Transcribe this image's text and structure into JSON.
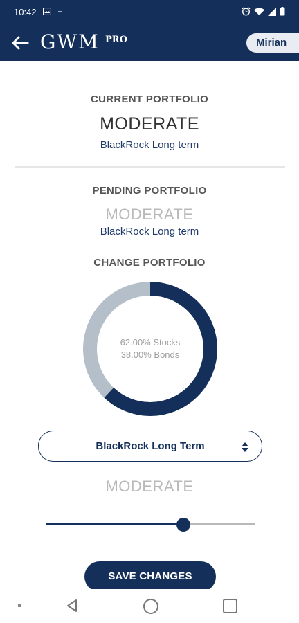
{
  "status_bar": {
    "time": "10:42"
  },
  "header": {
    "brand": "GWM",
    "brand_sup": "PRO",
    "user_name": "Mirian"
  },
  "current": {
    "title": "CURRENT PORTFOLIO",
    "level": "MODERATE",
    "provider": "BlackRock Long term"
  },
  "pending": {
    "title": "PENDING PORTFOLIO",
    "level": "MODERATE",
    "provider": "BlackRock Long term"
  },
  "change": {
    "title": "CHANGE PORTFOLIO",
    "stocks_text": "62.00% Stocks",
    "bonds_text": "38.00% Bonds",
    "stocks_fraction": 0.62,
    "stocks_color": "#14305a",
    "bonds_color": "#b5bfc9",
    "select_value": "BlackRock Long Term",
    "risk_level": "MODERATE",
    "slider_fraction": 0.66
  },
  "actions": {
    "save_label": "SAVE CHANGES"
  },
  "colors": {
    "brand": "#14305a",
    "muted": "#b9b9b9"
  }
}
